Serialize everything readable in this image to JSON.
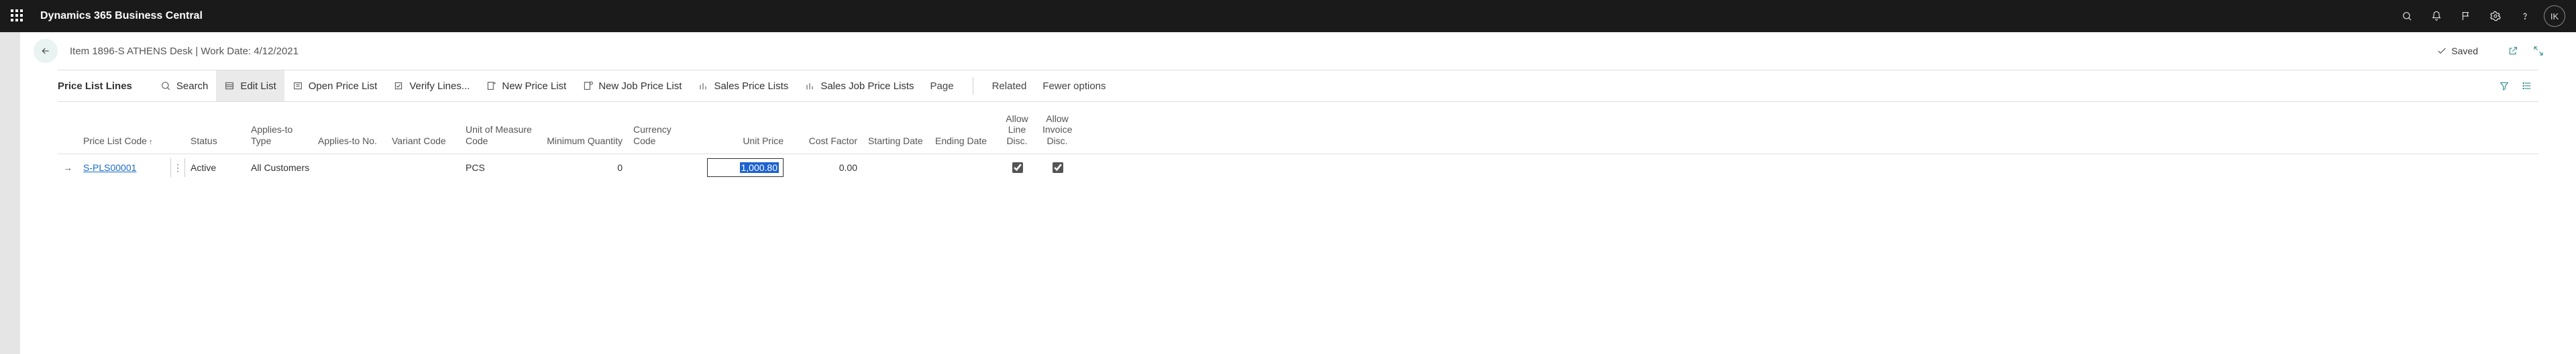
{
  "app": {
    "title": "Dynamics 365 Business Central",
    "avatar": "IK"
  },
  "header": {
    "breadcrumb": "Item 1896-S ATHENS Desk | Work Date: 4/12/2021",
    "saved": "Saved"
  },
  "cmdbar": {
    "title": "Price List Lines",
    "search": "Search",
    "edit_list": "Edit List",
    "open_price_list": "Open Price List",
    "verify_lines": "Verify Lines...",
    "new_price_list": "New Price List",
    "new_job_price_list": "New Job Price List",
    "sales_price_lists": "Sales Price Lists",
    "sales_job_price_lists": "Sales Job Price Lists",
    "page": "Page",
    "related": "Related",
    "fewer_options": "Fewer options"
  },
  "columns": {
    "code": "Price List Code",
    "status": "Status",
    "applies_type": "Applies-to Type",
    "applies_no": "Applies-to No.",
    "variant": "Variant Code",
    "uom": "Unit of Measure Code",
    "min_qty": "Minimum Quantity",
    "currency": "Currency Code",
    "unit_price": "Unit Price",
    "cost_factor": "Cost Factor",
    "start_date": "Starting Date",
    "end_date": "Ending Date",
    "allow_line": "Allow Line Disc.",
    "allow_inv": "Allow Invoice Disc."
  },
  "rows": [
    {
      "code": "S-PLS00001",
      "status": "Active",
      "applies_type": "All Customers",
      "applies_no": "",
      "variant": "",
      "uom": "PCS",
      "min_qty": "0",
      "currency": "",
      "unit_price": "1,000.80",
      "cost_factor": "0.00",
      "start_date": "",
      "end_date": "",
      "allow_line": true,
      "allow_inv": true
    }
  ]
}
